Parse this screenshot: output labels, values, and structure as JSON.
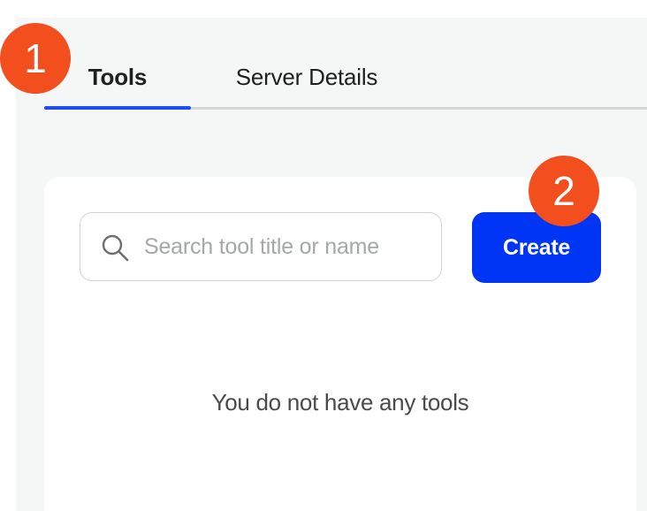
{
  "tabs": [
    {
      "label": "Tools",
      "active": true
    },
    {
      "label": "Server Details",
      "active": false
    }
  ],
  "search": {
    "placeholder": "Search tool title or name",
    "value": ""
  },
  "create_button": {
    "label": "Create"
  },
  "empty_state": {
    "message": "You do not have any tools"
  },
  "markers": [
    "1",
    "2"
  ],
  "colors": {
    "accent": "#0035f5",
    "tab_underline": "#1d4ef5",
    "marker": "#f24e1e",
    "panel_background": "#f4f7f5"
  },
  "icons": {
    "search": "search-icon"
  }
}
